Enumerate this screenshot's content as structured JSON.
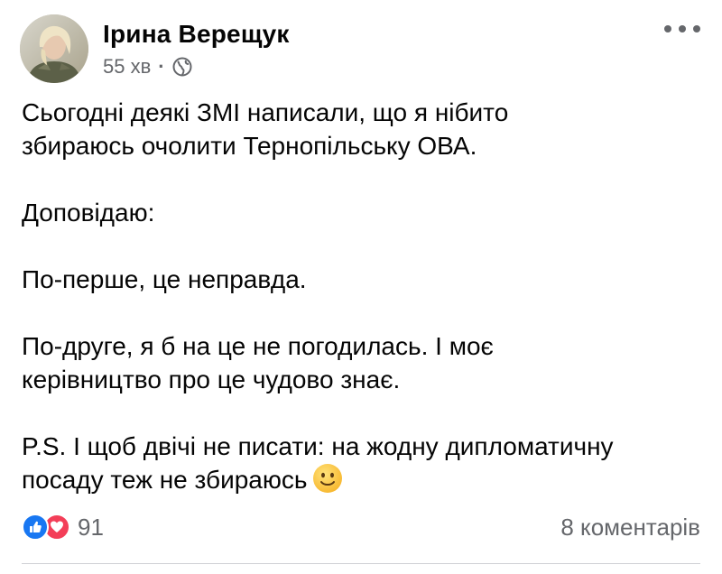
{
  "post": {
    "author": "Ірина Верещук",
    "time": "55 хв",
    "separator": "·",
    "audience_icon": "globe-icon",
    "more_icon": "ellipsis-icon",
    "paragraphs": [
      [
        "Сьогодні деякі ЗМІ написали, що я нібито",
        "збираюсь очолити Тернопільську ОВА."
      ],
      [
        "Доповідаю:"
      ],
      [
        "По-перше, це неправда."
      ],
      [
        "По-друге, я б на це не погодилась. І моє",
        "керівництво про це чудово знає."
      ],
      [
        "P.S. І щоб двічі не писати: на жодну дипломатичну",
        "посаду теж не збираюсь"
      ]
    ],
    "emoji": "slightly-smiling-face",
    "reactions": {
      "types": [
        "like",
        "love"
      ],
      "count": "91"
    },
    "comments_label": "8 коментарів",
    "colors": {
      "like": "#1877f2",
      "love": "#f33e58",
      "secondary_text": "#65676b",
      "primary_text": "#050505"
    }
  }
}
